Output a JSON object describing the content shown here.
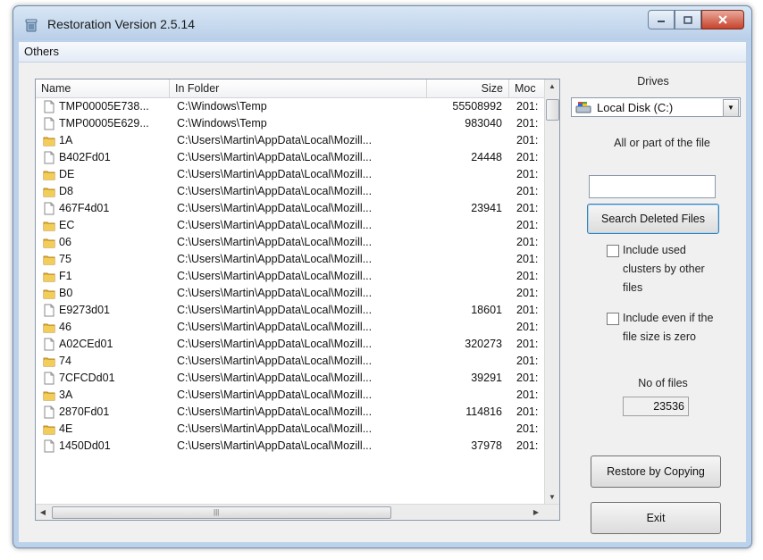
{
  "window": {
    "title": "Restoration Version 2.5.14"
  },
  "menu": {
    "items": [
      "Others"
    ]
  },
  "table": {
    "columns": [
      "Name",
      "In Folder",
      "Size",
      "Moc"
    ],
    "rows": [
      {
        "icon": "file",
        "name": "TMP00005E738...",
        "folder": "C:\\Windows\\Temp",
        "size": "55508992",
        "mod": "201:"
      },
      {
        "icon": "file",
        "name": "TMP00005E629...",
        "folder": "C:\\Windows\\Temp",
        "size": "983040",
        "mod": "201:"
      },
      {
        "icon": "folder",
        "name": "1A",
        "folder": "C:\\Users\\Martin\\AppData\\Local\\Mozill...",
        "size": "",
        "mod": "201:"
      },
      {
        "icon": "file",
        "name": "B402Fd01",
        "folder": "C:\\Users\\Martin\\AppData\\Local\\Mozill...",
        "size": "24448",
        "mod": "201:"
      },
      {
        "icon": "folder",
        "name": "DE",
        "folder": "C:\\Users\\Martin\\AppData\\Local\\Mozill...",
        "size": "",
        "mod": "201:"
      },
      {
        "icon": "folder",
        "name": "D8",
        "folder": "C:\\Users\\Martin\\AppData\\Local\\Mozill...",
        "size": "",
        "mod": "201:"
      },
      {
        "icon": "file",
        "name": "467F4d01",
        "folder": "C:\\Users\\Martin\\AppData\\Local\\Mozill...",
        "size": "23941",
        "mod": "201:"
      },
      {
        "icon": "folder",
        "name": "EC",
        "folder": "C:\\Users\\Martin\\AppData\\Local\\Mozill...",
        "size": "",
        "mod": "201:"
      },
      {
        "icon": "folder",
        "name": "06",
        "folder": "C:\\Users\\Martin\\AppData\\Local\\Mozill...",
        "size": "",
        "mod": "201:"
      },
      {
        "icon": "folder",
        "name": "75",
        "folder": "C:\\Users\\Martin\\AppData\\Local\\Mozill...",
        "size": "",
        "mod": "201:"
      },
      {
        "icon": "folder",
        "name": "F1",
        "folder": "C:\\Users\\Martin\\AppData\\Local\\Mozill...",
        "size": "",
        "mod": "201:"
      },
      {
        "icon": "folder",
        "name": "B0",
        "folder": "C:\\Users\\Martin\\AppData\\Local\\Mozill...",
        "size": "",
        "mod": "201:"
      },
      {
        "icon": "file",
        "name": "E9273d01",
        "folder": "C:\\Users\\Martin\\AppData\\Local\\Mozill...",
        "size": "18601",
        "mod": "201:"
      },
      {
        "icon": "folder",
        "name": "46",
        "folder": "C:\\Users\\Martin\\AppData\\Local\\Mozill...",
        "size": "",
        "mod": "201:"
      },
      {
        "icon": "file",
        "name": "A02CEd01",
        "folder": "C:\\Users\\Martin\\AppData\\Local\\Mozill...",
        "size": "320273",
        "mod": "201:"
      },
      {
        "icon": "folder",
        "name": "74",
        "folder": "C:\\Users\\Martin\\AppData\\Local\\Mozill...",
        "size": "",
        "mod": "201:"
      },
      {
        "icon": "file",
        "name": "7CFCDd01",
        "folder": "C:\\Users\\Martin\\AppData\\Local\\Mozill...",
        "size": "39291",
        "mod": "201:"
      },
      {
        "icon": "folder",
        "name": "3A",
        "folder": "C:\\Users\\Martin\\AppData\\Local\\Mozill...",
        "size": "",
        "mod": "201:"
      },
      {
        "icon": "file",
        "name": "2870Fd01",
        "folder": "C:\\Users\\Martin\\AppData\\Local\\Mozill...",
        "size": "114816",
        "mod": "201:"
      },
      {
        "icon": "folder",
        "name": "4E",
        "folder": "C:\\Users\\Martin\\AppData\\Local\\Mozill...",
        "size": "",
        "mod": "201:"
      },
      {
        "icon": "file",
        "name": "1450Dd01",
        "folder": "C:\\Users\\Martin\\AppData\\Local\\Mozill...",
        "size": "37978",
        "mod": "201:"
      }
    ]
  },
  "sidebar": {
    "drives_label": "Drives",
    "drive_selected": "Local Disk (C:)",
    "file_filter_label": "All or part of the file",
    "file_filter_value": "",
    "search_button": "Search Deleted Files",
    "include_used_clusters_label": "Include used clusters by other files",
    "include_used_clusters_checked": false,
    "include_zero_size_label": "Include even if the file size is zero",
    "include_zero_size_checked": false,
    "no_of_files_label": "No of files",
    "no_of_files_value": "23536",
    "restore_button": "Restore by Copying",
    "exit_button": "Exit"
  },
  "colors": {
    "folder": "#e8b83a",
    "title_bar": "#c9dcf0",
    "close_button": "#c7432c"
  }
}
